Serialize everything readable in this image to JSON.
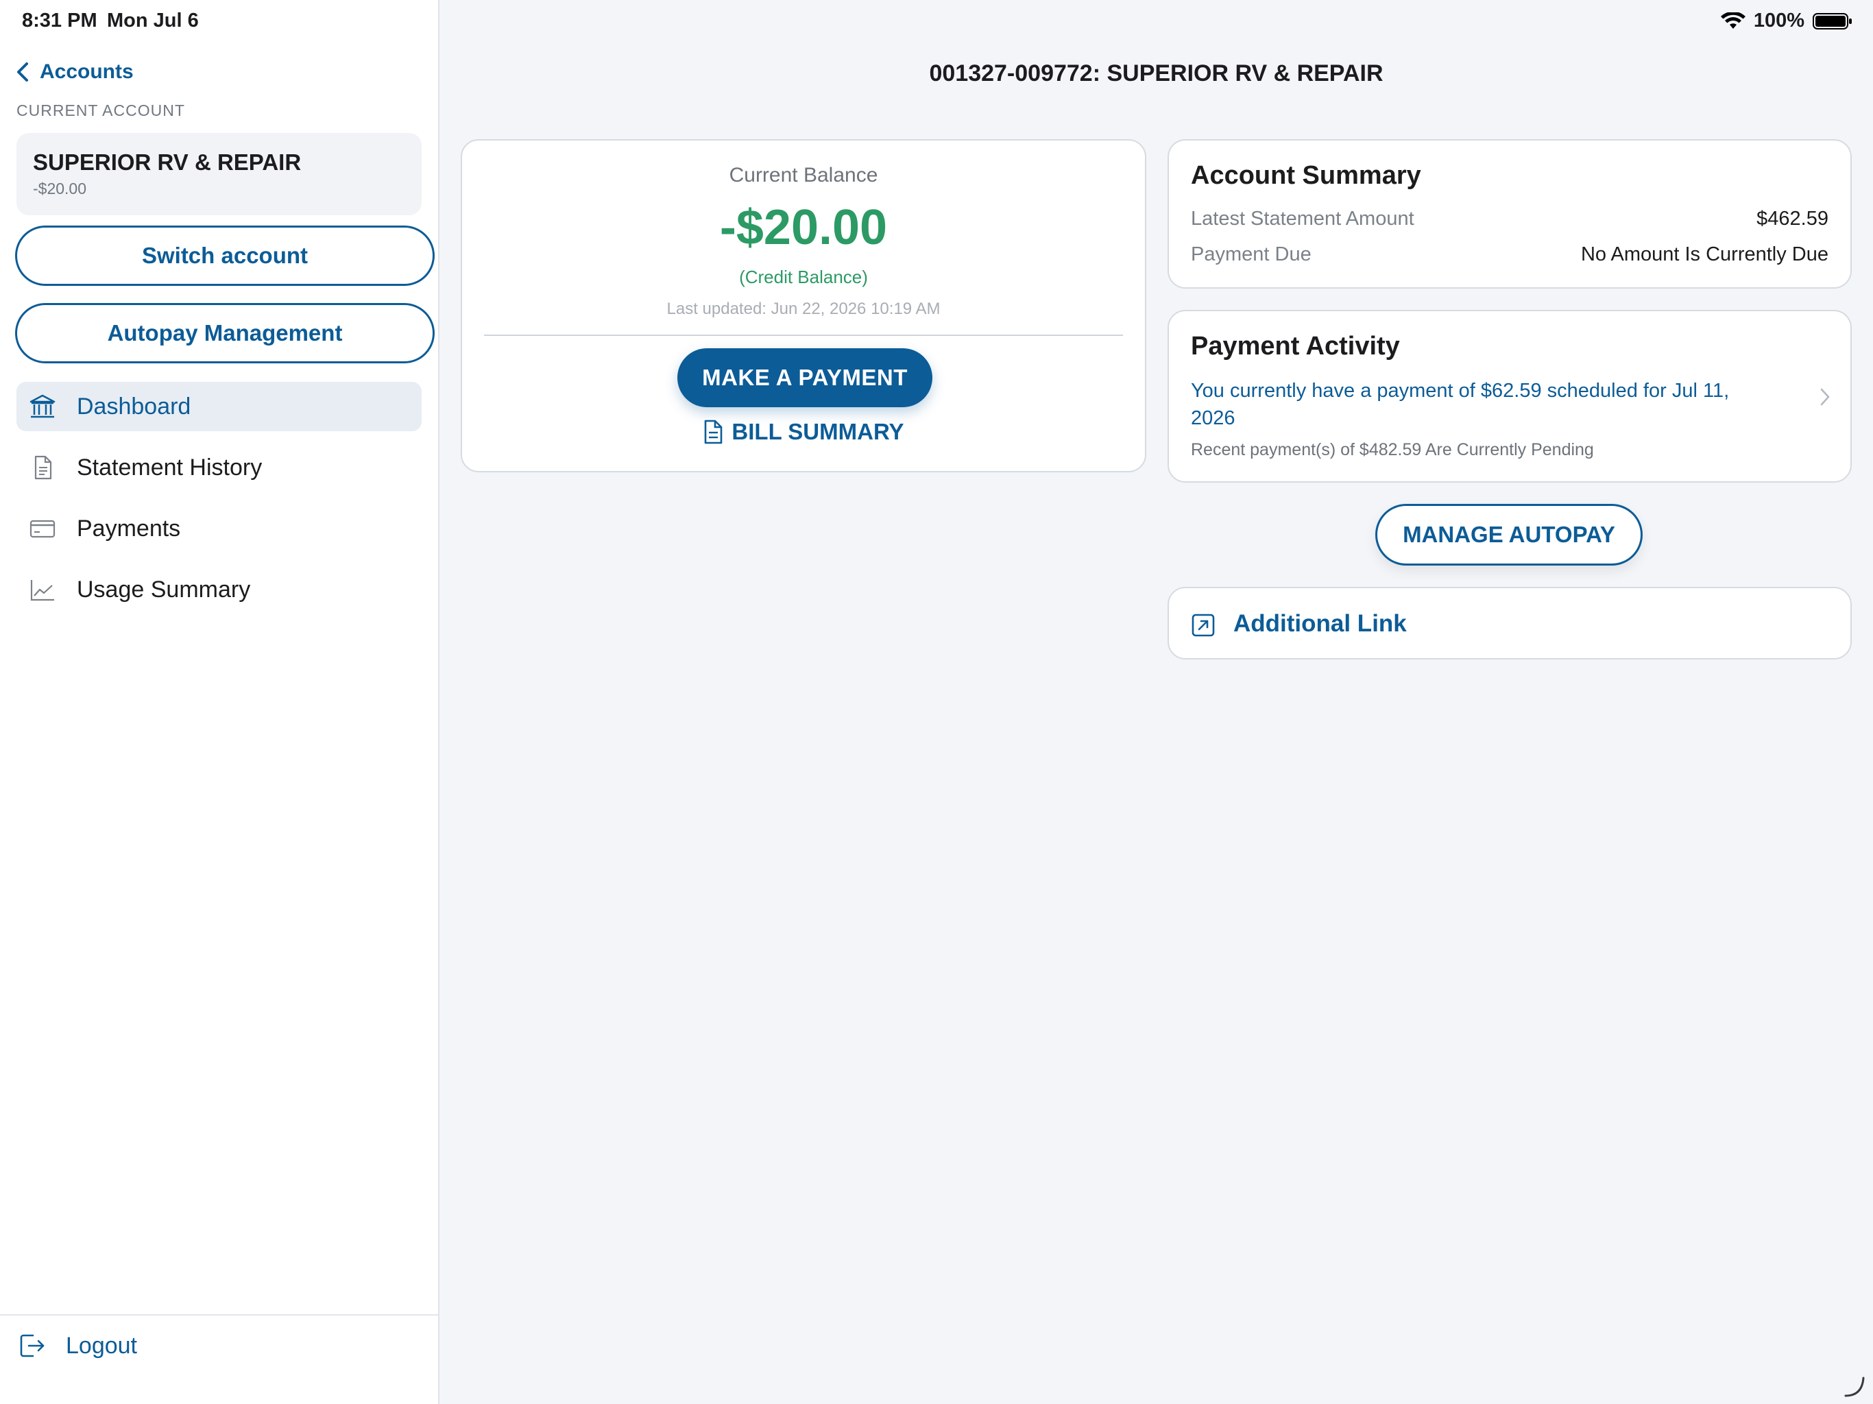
{
  "status_bar": {
    "time": "8:31 PM",
    "date": "Mon Jul 6",
    "battery": "100%"
  },
  "sidebar": {
    "back_label": "Accounts",
    "section_label": "CURRENT ACCOUNT",
    "account_name": "SUPERIOR RV & REPAIR",
    "account_balance": "-$20.00",
    "switch_account_label": "Switch account",
    "autopay_management_label": "Autopay Management",
    "nav": [
      {
        "label": "Dashboard",
        "icon": "bank-icon",
        "active": true
      },
      {
        "label": "Statement History",
        "icon": "document-icon",
        "active": false
      },
      {
        "label": "Payments",
        "icon": "credit-card-icon",
        "active": false
      },
      {
        "label": "Usage Summary",
        "icon": "line-chart-icon",
        "active": false
      }
    ],
    "logout_label": "Logout"
  },
  "header": {
    "title": "001327-009772: SUPERIOR RV & REPAIR"
  },
  "balance": {
    "label": "Current Balance",
    "amount": "-$20.00",
    "credit_note": "(Credit Balance)",
    "last_updated": "Last updated: Jun 22, 2026 10:19 AM",
    "pay_button": "MAKE A PAYMENT",
    "bill_summary": "BILL SUMMARY"
  },
  "account_summary": {
    "title": "Account Summary",
    "latest_statement_label": "Latest Statement Amount",
    "latest_statement_value": "$462.59",
    "payment_due_label": "Payment Due",
    "payment_due_value": "No Amount Is Currently Due"
  },
  "payment_activity": {
    "title": "Payment Activity",
    "scheduled_text": "You currently have a payment of $62.59 scheduled for Jul 11, 2026",
    "pending_text": "Recent payment(s) of $482.59 Are Currently Pending"
  },
  "manage_autopay_label": "MANAGE AUTOPAY",
  "additional_link_label": "Additional Link",
  "colors": {
    "brand": "#0c5c97",
    "credit": "#2c9a64",
    "background": "#f3f5f8"
  }
}
